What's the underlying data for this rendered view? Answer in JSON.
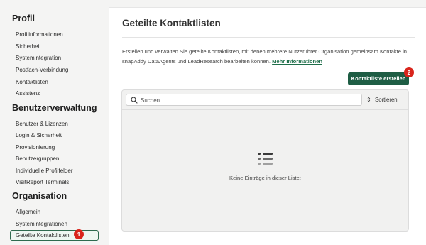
{
  "sidebar": {
    "sections": [
      {
        "title": "Profil",
        "items": [
          "Profilinformationen",
          "Sicherheit",
          "Systemintegration",
          "Postfach-Verbindung",
          "Kontaktlisten",
          "Assistenz"
        ]
      },
      {
        "title": "Benutzerverwaltung",
        "items": [
          "Benutzer & Lizenzen",
          "Login & Sicherheit",
          "Provisionierung",
          "Benutzergruppen",
          "Individuelle Profilfelder",
          "VisitReport Terminals"
        ]
      },
      {
        "title": "Organisation",
        "items": [
          "Allgemein",
          "Systemintegrationen",
          "Geteilte Kontaktlisten"
        ]
      }
    ],
    "active_item": "Geteilte Kontaktlisten"
  },
  "main": {
    "title": "Geteilte Kontaktlisten",
    "description": "Erstellen und verwalten Sie geteilte Kontaktlisten, mit denen mehrere Nutzer Ihrer Organisation gemeinsam Kontakte in snapAddy DataAgents und LeadResearch bearbeiten können.",
    "more_info_link": "Mehr Informationen",
    "create_button": "Kontaktliste erstellen",
    "search": {
      "placeholder": "Suchen",
      "value": ""
    },
    "sort_label": "Sortieren",
    "empty_text": "Keine Einträge in dieser Liste;"
  },
  "annotations": {
    "badge_1": "1",
    "badge_2": "2",
    "badge_color": "#d9251c"
  },
  "colors": {
    "accent": "#1e5d44",
    "link": "#1f6e4a",
    "active_border": "#2e6b4f"
  }
}
